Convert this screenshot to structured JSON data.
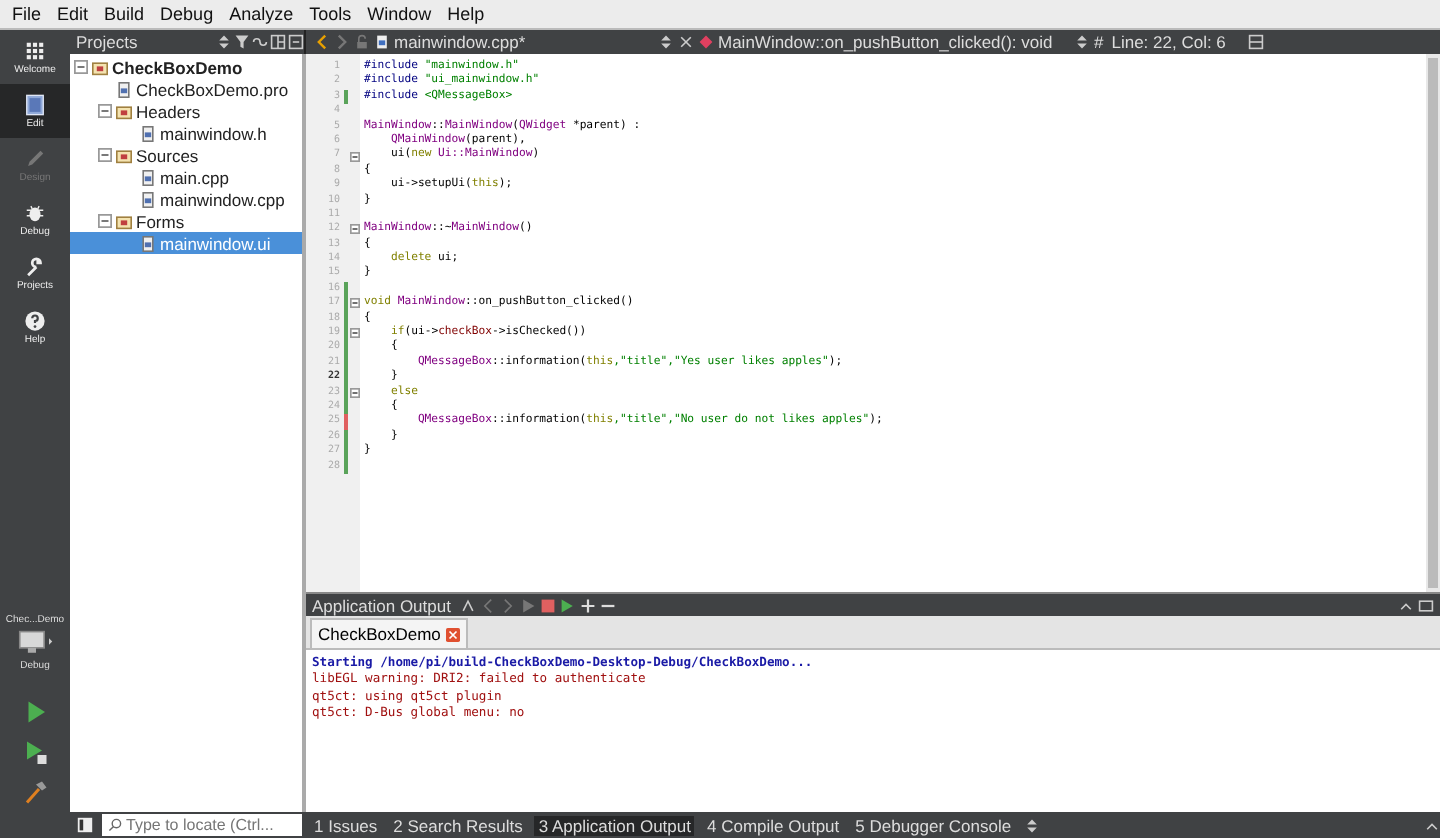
{
  "menu": [
    "File",
    "Edit",
    "Build",
    "Debug",
    "Analyze",
    "Tools",
    "Window",
    "Help"
  ],
  "modes": [
    {
      "label": "Welcome",
      "selected": false,
      "disabled": false
    },
    {
      "label": "Edit",
      "selected": true,
      "disabled": false
    },
    {
      "label": "Design",
      "selected": false,
      "disabled": true
    },
    {
      "label": "Debug",
      "selected": false,
      "disabled": false
    },
    {
      "label": "Projects",
      "selected": false,
      "disabled": false
    },
    {
      "label": "Help",
      "selected": false,
      "disabled": false
    }
  ],
  "kit": {
    "project": "Chec...Demo",
    "build": "Debug"
  },
  "projects_panel": {
    "title": "Projects",
    "tree": [
      {
        "label": "CheckBoxDemo",
        "expanded": true,
        "selected": false,
        "children": [
          {
            "label": "CheckBoxDemo.pro",
            "selected": false
          },
          {
            "label": "Headers",
            "expanded": true,
            "selected": false,
            "children": [
              {
                "label": "mainwindow.h",
                "selected": false
              }
            ]
          },
          {
            "label": "Sources",
            "expanded": true,
            "selected": false,
            "children": [
              {
                "label": "main.cpp",
                "selected": false
              },
              {
                "label": "mainwindow.cpp",
                "selected": false
              }
            ]
          },
          {
            "label": "Forms",
            "expanded": true,
            "selected": false,
            "children": [
              {
                "label": "mainwindow.ui",
                "selected": true
              }
            ]
          }
        ]
      }
    ]
  },
  "editor": {
    "file": "mainwindow.cpp*",
    "symbol": "MainWindow::on_pushButton_clicked(): void",
    "hash": "#",
    "position": "Line: 22, Col: 6",
    "lines": [
      {
        "number": "1",
        "foldable": false,
        "current": false,
        "tokens": [
          {
            "kind": "preprocessor",
            "text": "#include "
          },
          {
            "kind": "string",
            "text": "\"mainwindow.h\""
          }
        ]
      },
      {
        "number": "2",
        "foldable": false,
        "current": false,
        "tokens": [
          {
            "kind": "preprocessor",
            "text": "#include "
          },
          {
            "kind": "string",
            "text": "\"ui_mainwindow.h\""
          }
        ]
      },
      {
        "number": "3",
        "color": "#5aa35a",
        "foldable": false,
        "current": false,
        "tokens": [
          {
            "kind": "preprocessor",
            "text": "#include "
          },
          {
            "kind": "string",
            "text": "<QMessageBox>"
          }
        ]
      },
      {
        "number": "4",
        "foldable": false,
        "current": false
      },
      {
        "number": "5",
        "foldable": false,
        "current": false,
        "tokens": [
          {
            "kind": "type",
            "text": "MainWindow"
          },
          {
            "kind": "plain",
            "text": "::"
          },
          {
            "kind": "type",
            "text": "MainWindow"
          },
          {
            "kind": "plain",
            "text": "("
          },
          {
            "kind": "type",
            "text": "QWidget"
          },
          {
            "kind": "plain",
            "text": " *parent) :"
          }
        ]
      },
      {
        "number": "6",
        "foldable": false,
        "current": false,
        "tokens": [
          {
            "kind": "type",
            "text": "    QMainWindow"
          },
          {
            "kind": "plain",
            "text": "(parent),"
          }
        ]
      },
      {
        "number": "7",
        "foldable": true,
        "current": false,
        "tokens": [
          {
            "kind": "plain",
            "text": "    ui("
          },
          {
            "kind": "keyword",
            "text": "new"
          },
          {
            "kind": "type",
            "text": " Ui::MainWindow"
          },
          {
            "kind": "plain",
            "text": ")"
          }
        ]
      },
      {
        "number": "8",
        "foldable": false,
        "current": false,
        "tokens": [
          {
            "kind": "plain",
            "text": "{"
          }
        ]
      },
      {
        "number": "9",
        "foldable": false,
        "current": false,
        "tokens": [
          {
            "kind": "plain",
            "text": "    ui->setupUi("
          },
          {
            "kind": "keyword",
            "text": "this"
          },
          {
            "kind": "plain",
            "text": ");"
          }
        ]
      },
      {
        "number": "10",
        "foldable": false,
        "current": false,
        "tokens": [
          {
            "kind": "plain",
            "text": "}"
          }
        ]
      },
      {
        "number": "11",
        "foldable": false,
        "current": false
      },
      {
        "number": "12",
        "foldable": true,
        "current": false,
        "tokens": [
          {
            "kind": "type",
            "text": "MainWindow"
          },
          {
            "kind": "plain",
            "text": "::~"
          },
          {
            "kind": "type",
            "text": "MainWindow"
          },
          {
            "kind": "plain",
            "text": "()"
          }
        ]
      },
      {
        "number": "13",
        "foldable": false,
        "current": false,
        "tokens": [
          {
            "kind": "plain",
            "text": "{"
          }
        ]
      },
      {
        "number": "14",
        "foldable": false,
        "current": false,
        "tokens": [
          {
            "kind": "keyword",
            "text": "    delete"
          },
          {
            "kind": "plain",
            "text": " ui;"
          }
        ]
      },
      {
        "number": "15",
        "foldable": false,
        "current": false,
        "tokens": [
          {
            "kind": "plain",
            "text": "}"
          }
        ]
      },
      {
        "number": "16",
        "color": "#5aa35a",
        "foldable": false,
        "current": false
      },
      {
        "number": "17",
        "color": "#5aa35a",
        "foldable": true,
        "current": false,
        "tokens": [
          {
            "kind": "keyword",
            "text": "void"
          },
          {
            "kind": "type",
            "text": " MainWindow"
          },
          {
            "kind": "plain",
            "text": "::on_pushButton_clicked()"
          }
        ]
      },
      {
        "number": "18",
        "color": "#5aa35a",
        "foldable": false,
        "current": false,
        "tokens": [
          {
            "kind": "plain",
            "text": "{"
          }
        ]
      },
      {
        "number": "19",
        "color": "#5aa35a",
        "foldable": true,
        "current": false,
        "tokens": [
          {
            "kind": "keyword",
            "text": "    if"
          },
          {
            "kind": "plain",
            "text": "(ui->"
          },
          {
            "kind": "member",
            "text": "checkBox"
          },
          {
            "kind": "plain",
            "text": "->isChecked())"
          }
        ]
      },
      {
        "number": "20",
        "color": "#5aa35a",
        "foldable": false,
        "current": false,
        "tokens": [
          {
            "kind": "plain",
            "text": "    {"
          }
        ]
      },
      {
        "number": "21",
        "color": "#5aa35a",
        "foldable": false,
        "current": false,
        "tokens": [
          {
            "kind": "type",
            "text": "        QMessageBox"
          },
          {
            "kind": "plain",
            "text": "::information("
          },
          {
            "kind": "keyword",
            "text": "this"
          },
          {
            "kind": "string",
            "text": ",\"title\",\"Yes user likes apples\""
          },
          {
            "kind": "plain",
            "text": ");"
          }
        ]
      },
      {
        "number": "22",
        "color": "#5aa35a",
        "foldable": false,
        "current": true,
        "tokens": [
          {
            "kind": "plain",
            "text": "    }"
          }
        ]
      },
      {
        "number": "23",
        "color": "#5aa35a",
        "foldable": true,
        "current": false,
        "tokens": [
          {
            "kind": "keyword",
            "text": "    else"
          }
        ]
      },
      {
        "number": "24",
        "color": "#5aa35a",
        "foldable": false,
        "current": false,
        "tokens": [
          {
            "kind": "plain",
            "text": "    {"
          }
        ]
      },
      {
        "number": "25",
        "color": "#e06060",
        "foldable": false,
        "current": false,
        "tokens": [
          {
            "kind": "type",
            "text": "        QMessageBox"
          },
          {
            "kind": "plain",
            "text": "::information("
          },
          {
            "kind": "keyword",
            "text": "this"
          },
          {
            "kind": "string",
            "text": ",\"title\",\"No user do not likes apples\""
          },
          {
            "kind": "plain",
            "text": ");"
          }
        ]
      },
      {
        "number": "26",
        "color": "#5aa35a",
        "foldable": false,
        "current": false,
        "tokens": [
          {
            "kind": "plain",
            "text": "    }"
          }
        ]
      },
      {
        "number": "27",
        "color": "#5aa35a",
        "foldable": false,
        "current": false,
        "tokens": [
          {
            "kind": "plain",
            "text": "}"
          }
        ]
      },
      {
        "number": "28",
        "color": "#5aa35a",
        "foldable": false,
        "current": false
      }
    ]
  },
  "output": {
    "title": "Application Output",
    "tab": "CheckBoxDemo",
    "lines": [
      {
        "kind": "info",
        "text": "Starting /home/pi/build-CheckBoxDemo-Desktop-Debug/CheckBoxDemo..."
      },
      {
        "kind": "error",
        "text": "libEGL warning: DRI2: failed to authenticate"
      },
      {
        "kind": "error",
        "text": "qt5ct: using qt5ct plugin"
      },
      {
        "kind": "error",
        "text": "qt5ct: D-Bus global menu: no"
      }
    ]
  },
  "locator": {
    "placeholder": "Type to locate (Ctrl..."
  },
  "panes": [
    {
      "label": "1 Issues",
      "selected": false
    },
    {
      "label": "2 Search Results",
      "selected": false
    },
    {
      "label": "3 Application Output",
      "selected": true
    },
    {
      "label": "4 Compile Output",
      "selected": false
    },
    {
      "label": "5 Debugger Console",
      "selected": false
    }
  ]
}
